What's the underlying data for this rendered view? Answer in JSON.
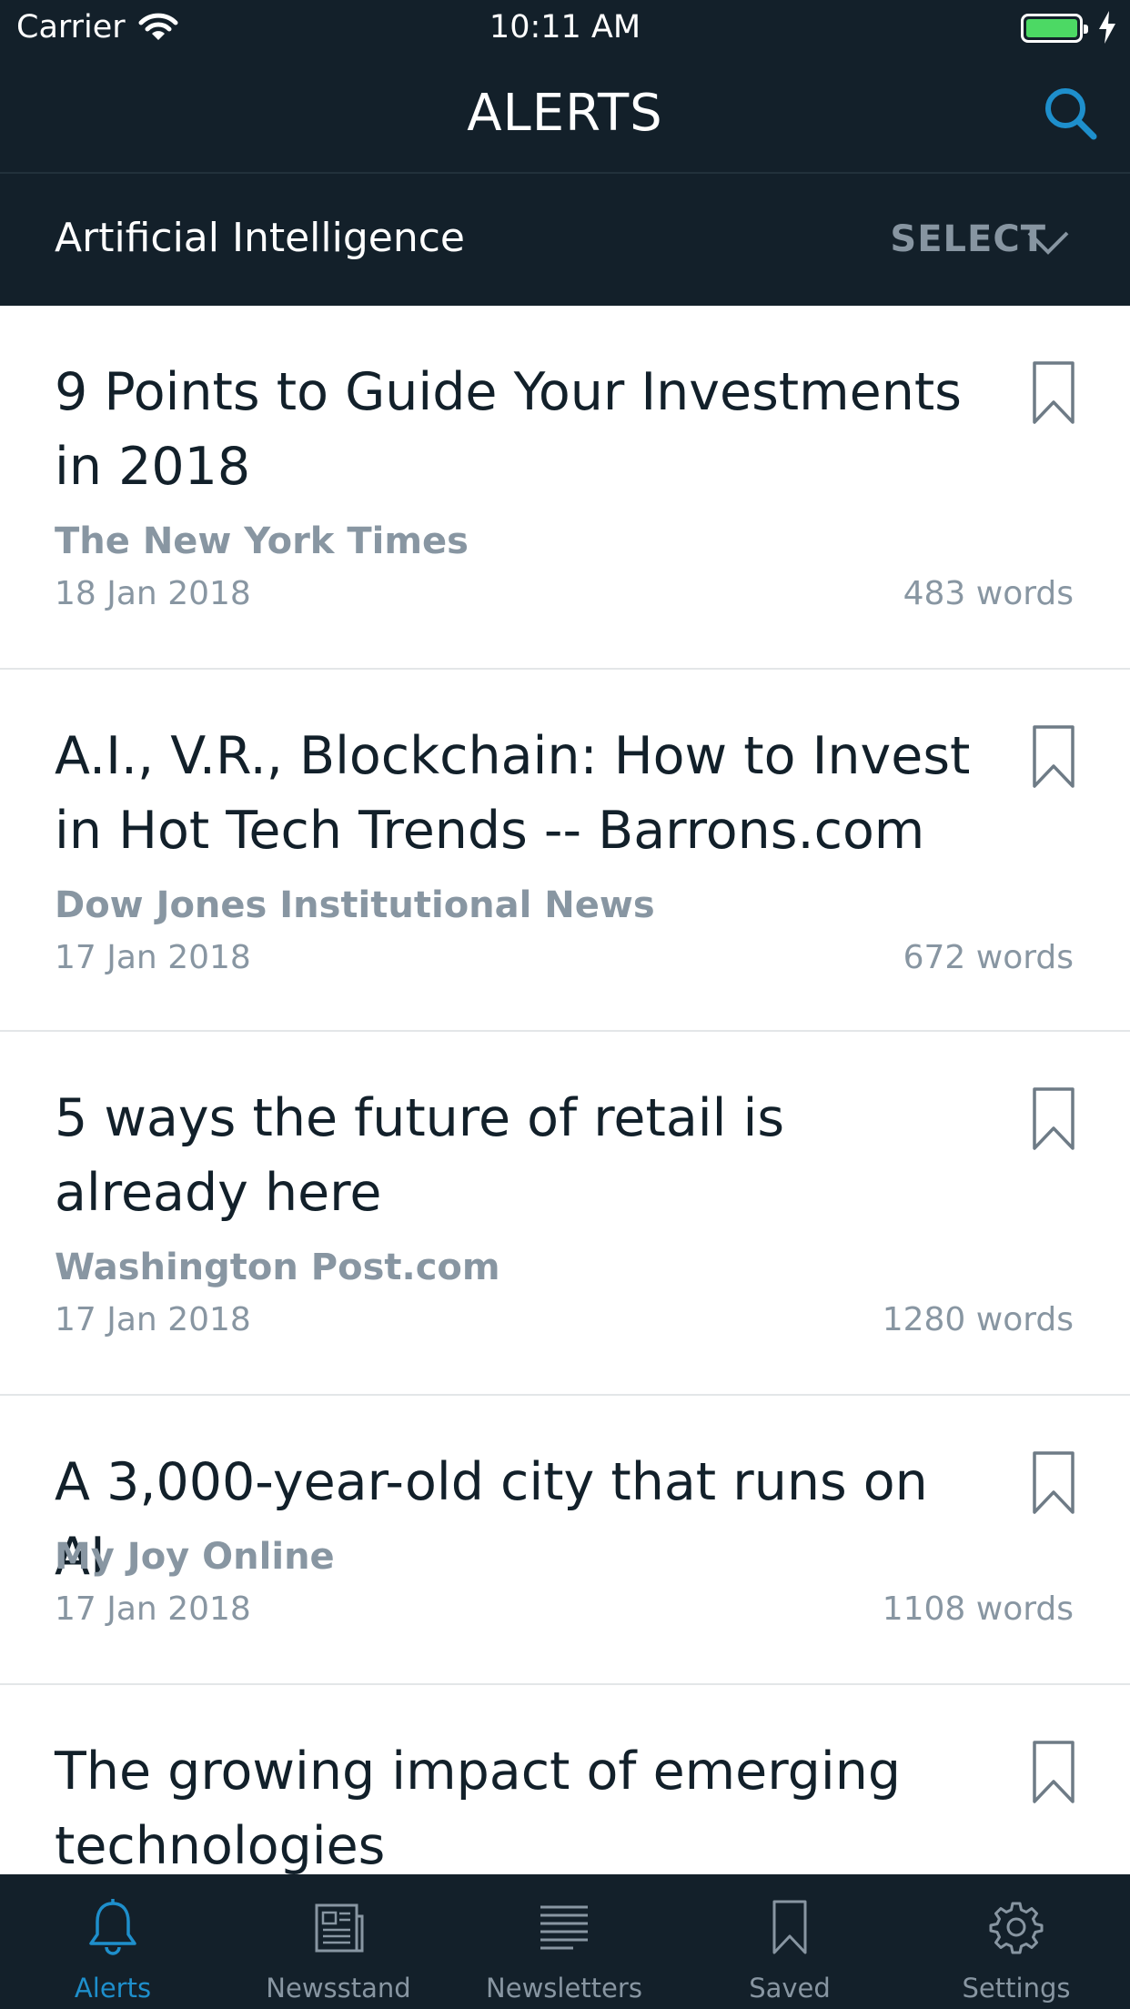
{
  "status_bar": {
    "carrier": "Carrier",
    "time": "10:11 AM"
  },
  "nav": {
    "title": "ALERTS"
  },
  "topic_bar": {
    "topic": "Artificial Intelligence",
    "select_label": "SELECT"
  },
  "articles": [
    {
      "headline": "9 Points to Guide Your Investments in 2018",
      "source": "The New York Times",
      "date": "18 Jan 2018",
      "words": "483 words"
    },
    {
      "headline": "A.I., V.R., Blockchain: How to Invest in Hot Tech Trends -- Barrons.com",
      "source": "Dow Jones Institutional News",
      "date": "17 Jan 2018",
      "words": "672 words"
    },
    {
      "headline": "5 ways the future of retail is already here",
      "source": "Washington Post.com",
      "date": "17 Jan 2018",
      "words": "1280 words"
    },
    {
      "headline": "A 3,000-year-old city that runs on AI",
      "source": "My Joy Online",
      "date": "17 Jan 2018",
      "words": "1108 words"
    },
    {
      "headline": "The growing impact of emerging technologies",
      "source": "",
      "date": "",
      "words": ""
    }
  ],
  "tabs": [
    {
      "label": "Alerts",
      "icon": "bell-icon",
      "active": true
    },
    {
      "label": "Newsstand",
      "icon": "newspaper-icon",
      "active": false
    },
    {
      "label": "Newsletters",
      "icon": "lines-icon",
      "active": false
    },
    {
      "label": "Saved",
      "icon": "bookmark-icon",
      "active": false
    },
    {
      "label": "Settings",
      "icon": "gear-icon",
      "active": false
    }
  ],
  "colors": {
    "header_bg": "#13202a",
    "accent": "#1e8fcc",
    "muted": "#8896a2",
    "text": "#12202a"
  }
}
